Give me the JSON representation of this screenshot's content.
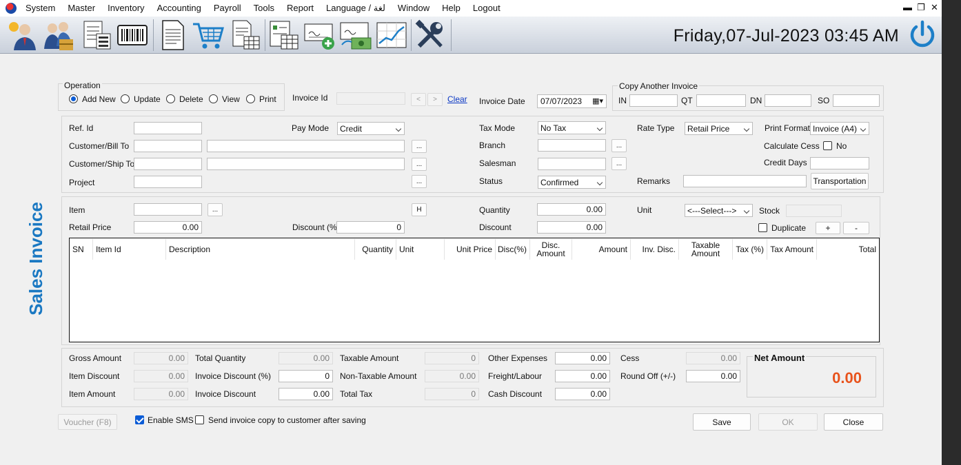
{
  "menu": [
    "System",
    "Master",
    "Inventory",
    "Accounting",
    "Payroll",
    "Tools",
    "Report",
    "Language / لغة",
    "Window",
    "Help",
    "Logout"
  ],
  "window_controls": {
    "minimize": "▬",
    "restore": "❐",
    "close": "✕"
  },
  "toolbar": {
    "buttons": [
      "customer-icon",
      "supplier-icon",
      "product-list-icon",
      "barcode-icon",
      "document-icon",
      "cart-icon",
      "invoice-table-icon",
      "report-table-icon",
      "cheque-add-icon",
      "cheque-payment-icon",
      "trend-chart-icon",
      "tools-icon"
    ],
    "datetime": "Friday,07-Jul-2023   03:45 AM"
  },
  "page_title": "Sales Invoice",
  "operation": {
    "label": "Operation",
    "options": [
      "Add New",
      "Update",
      "Delete",
      "View",
      "Print"
    ],
    "selected": "Add New"
  },
  "invoice_id": {
    "label": "Invoice Id",
    "value": "",
    "prev": "<",
    "next": ">",
    "clear_label": "Clear"
  },
  "invoice_date": {
    "label": "Invoice Date",
    "value": "07/07/2023"
  },
  "copy_invoice": {
    "label": "Copy Another Invoice",
    "fields": [
      "IN",
      "QT",
      "DN",
      "SO"
    ]
  },
  "header": {
    "ref_id": "Ref. Id",
    "customer_bill": "Customer/Bill To",
    "customer_ship": "Customer/Ship To",
    "project": "Project",
    "pay_mode": {
      "label": "Pay Mode",
      "value": "Credit"
    },
    "tax_mode": {
      "label": "Tax Mode",
      "value": "No Tax"
    },
    "branch": "Branch",
    "salesman": "Salesman",
    "status": {
      "label": "Status",
      "value": "Confirmed"
    },
    "rate_type": {
      "label": "Rate Type",
      "value": "Retail Price"
    },
    "print_format": {
      "label": "Print Format",
      "value": "Invoice (A4)"
    },
    "calculate_cess": {
      "label": "Calculate Cess",
      "option": "No"
    },
    "credit_days": "Credit Days",
    "remarks": "Remarks",
    "transportation": "Transportation",
    "ellipsis": "...",
    "h_button": "H"
  },
  "item_entry": {
    "item": "Item",
    "retail_price": {
      "label": "Retail Price",
      "value": "0.00"
    },
    "discount_pct": {
      "label": "Discount (%)",
      "value": "0"
    },
    "quantity": {
      "label": "Quantity",
      "value": "0.00"
    },
    "discount": {
      "label": "Discount",
      "value": "0.00"
    },
    "unit": {
      "label": "Unit",
      "value": "<---Select--->"
    },
    "stock": "Stock",
    "duplicate": "Duplicate",
    "plus": "+",
    "minus": "-"
  },
  "grid_columns": [
    "SN",
    "Item Id",
    "Description",
    "Quantity",
    "Unit",
    "Unit Price",
    "Disc(%)",
    "Disc. Amount",
    "Amount",
    "Inv. Disc.",
    "Taxable Amount",
    "Tax (%)",
    "Tax Amount",
    "Total"
  ],
  "totals": {
    "gross_amount": {
      "label": "Gross Amount",
      "value": "0.00"
    },
    "item_discount": {
      "label": "Item Discount",
      "value": "0.00"
    },
    "item_amount": {
      "label": "Item Amount",
      "value": "0.00"
    },
    "total_quantity": {
      "label": "Total Quantity",
      "value": "0.00"
    },
    "invoice_discount_pct": {
      "label": "Invoice Discount (%)",
      "value": "0"
    },
    "invoice_discount": {
      "label": "Invoice Discount",
      "value": "0.00"
    },
    "taxable_amount": {
      "label": "Taxable Amount",
      "value": "0"
    },
    "non_taxable_amount": {
      "label": "Non-Taxable Amount",
      "value": "0.00"
    },
    "total_tax": {
      "label": "Total Tax",
      "value": "0"
    },
    "other_expenses": {
      "label": "Other Expenses",
      "value": "0.00"
    },
    "freight_labour": {
      "label": "Freight/Labour",
      "value": "0.00"
    },
    "cash_discount": {
      "label": "Cash Discount",
      "value": "0.00"
    },
    "cess": {
      "label": "Cess",
      "value": "0.00"
    },
    "round_off": {
      "label": "Round Off (+/-)",
      "value": "0.00"
    },
    "net_amount": {
      "label": "Net Amount",
      "value": "0.00"
    }
  },
  "footer": {
    "voucher": "Voucher (F8)",
    "enable_sms": "Enable SMS",
    "send_copy": "Send invoice copy to customer after saving",
    "save": "Save",
    "ok": "OK",
    "close": "Close"
  },
  "colors": {
    "title_blue": "#1a78c2",
    "net_amount": "#e8531c",
    "radio_blue": "#0b5cd6"
  }
}
